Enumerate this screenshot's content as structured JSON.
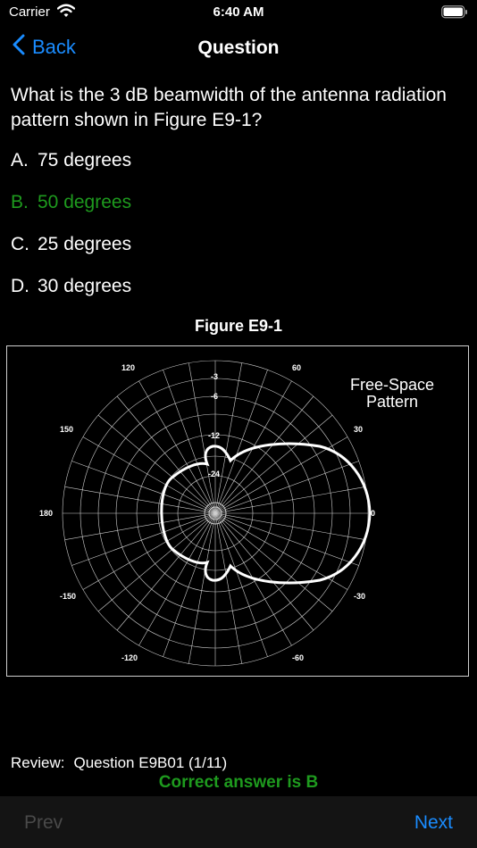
{
  "status_bar": {
    "carrier": "Carrier",
    "time": "6:40 AM"
  },
  "nav": {
    "back_label": "Back",
    "title": "Question"
  },
  "question": {
    "text": "What is the 3 dB beamwidth of the antenna radiation pattern shown in Figure E9-1?"
  },
  "answers": [
    {
      "letter": "A.",
      "text": "75 degrees",
      "correct": false
    },
    {
      "letter": "B.",
      "text": "50 degrees",
      "correct": true
    },
    {
      "letter": "C.",
      "text": "25 degrees",
      "correct": false
    },
    {
      "letter": "D.",
      "text": "30 degrees",
      "correct": false
    }
  ],
  "figure": {
    "title": "Figure E9-1",
    "caption_line1": "Free-Space",
    "caption_line2": "Pattern",
    "angle_labels": {
      "a0": "0",
      "a30": "30",
      "a60": "60",
      "a120": "120",
      "a150": "150",
      "a180": "180",
      "a_150": "-150",
      "a_120": "-120",
      "a_60": "-60",
      "a_30": "-30"
    },
    "ring_labels": {
      "r3": "-3",
      "r6": "-6",
      "r12": "-12",
      "r24": "-24"
    }
  },
  "review": {
    "label": "Review:",
    "value": "Question E9B01 (1/11)"
  },
  "result_text": "Correct answer is B",
  "toolbar": {
    "prev_label": "Prev",
    "next_label": "Next"
  },
  "colors": {
    "accent": "#1a8cff",
    "correct": "#1e9a1e",
    "disabled": "#4a4a4a"
  }
}
